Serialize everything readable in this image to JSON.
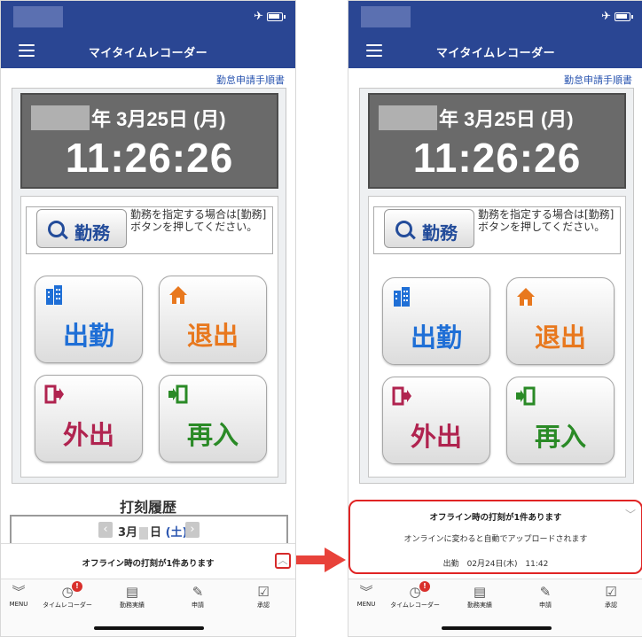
{
  "app": {
    "title": "マイタイムレコーダー",
    "guide_link": "勤怠申請手順書"
  },
  "clock": {
    "year_suffix": "年",
    "date": "3月25日 (月)",
    "time": "11:26:26"
  },
  "kinmu": {
    "button_label": "勤務",
    "help_text": "勤務を指定する場合は[勤務]ボタンを押してください。"
  },
  "punch_buttons": {
    "clock_in": "出勤",
    "clock_out": "退出",
    "go_out": "外出",
    "return": "再入"
  },
  "history": {
    "title": "打刻履歴",
    "month": "3月",
    "day_suffix": "日",
    "weekday": "(土)"
  },
  "offline": {
    "title": "オフライン時の打刻が1件あります",
    "message": "オンラインに変わると自動でアップロードされます",
    "entry_type": "出勤",
    "entry_date": "02月24日(木)",
    "entry_time": "11:42"
  },
  "tabbar": [
    {
      "label": "MENU",
      "icon": "chevrons-down-icon"
    },
    {
      "label": "タイムレコーダー",
      "icon": "clock-icon",
      "badge": "!"
    },
    {
      "label": "勤務実績",
      "icon": "document-icon"
    },
    {
      "label": "申請",
      "icon": "edit-document-icon"
    },
    {
      "label": "承認",
      "icon": "approve-document-icon"
    }
  ],
  "colors": {
    "header": "#2a4693",
    "clock_in": "#1f6fd6",
    "clock_out": "#e8781e",
    "go_out": "#b0234f",
    "return": "#2a8a26",
    "highlight": "#e02424"
  }
}
